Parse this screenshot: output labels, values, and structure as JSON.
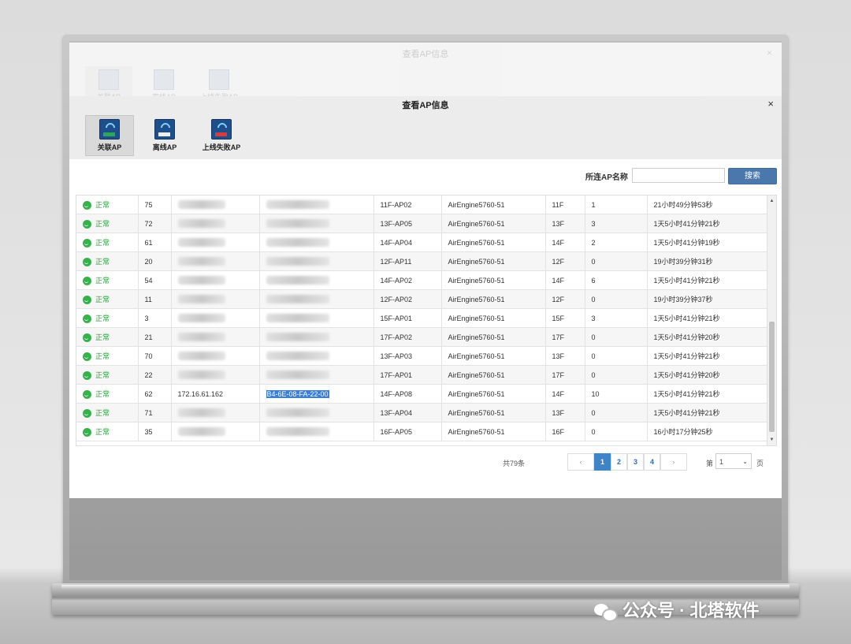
{
  "dialog": {
    "title": "查看AP信息",
    "close": "×",
    "tabs": [
      {
        "label": "关联AP",
        "icon": "associated-ap-icon",
        "active": true
      },
      {
        "label": "离线AP",
        "icon": "offline-ap-icon",
        "active": false
      },
      {
        "label": "上线失败AP",
        "icon": "online-failed-ap-icon",
        "active": false
      }
    ]
  },
  "search": {
    "label": "所连AP名称",
    "placeholder": "",
    "button": "搜索"
  },
  "rows": [
    {
      "status": "正常",
      "id": "75",
      "ip": "",
      "mac": "",
      "ap": "11F-AP02",
      "model": "AirEngine5760-51",
      "floor": "11F",
      "users": "1",
      "uptime": "21小时49分钟53秒"
    },
    {
      "status": "正常",
      "id": "72",
      "ip": "",
      "mac": "",
      "ap": "13F-AP05",
      "model": "AirEngine5760-51",
      "floor": "13F",
      "users": "3",
      "uptime": "1天5小时41分钟21秒"
    },
    {
      "status": "正常",
      "id": "61",
      "ip": "",
      "mac": "",
      "ap": "14F-AP04",
      "model": "AirEngine5760-51",
      "floor": "14F",
      "users": "2",
      "uptime": "1天5小时41分钟19秒"
    },
    {
      "status": "正常",
      "id": "20",
      "ip": "",
      "mac": "",
      "ap": "12F-AP11",
      "model": "AirEngine5760-51",
      "floor": "12F",
      "users": "0",
      "uptime": "19小时39分钟31秒"
    },
    {
      "status": "正常",
      "id": "54",
      "ip": "",
      "mac": "",
      "ap": "14F-AP02",
      "model": "AirEngine5760-51",
      "floor": "14F",
      "users": "6",
      "uptime": "1天5小时41分钟21秒"
    },
    {
      "status": "正常",
      "id": "11",
      "ip": "",
      "mac": "",
      "ap": "12F-AP02",
      "model": "AirEngine5760-51",
      "floor": "12F",
      "users": "0",
      "uptime": "19小时39分钟37秒"
    },
    {
      "status": "正常",
      "id": "3",
      "ip": "",
      "mac": "",
      "ap": "15F-AP01",
      "model": "AirEngine5760-51",
      "floor": "15F",
      "users": "3",
      "uptime": "1天5小时41分钟21秒"
    },
    {
      "status": "正常",
      "id": "21",
      "ip": "",
      "mac": "",
      "ap": "17F-AP02",
      "model": "AirEngine5760-51",
      "floor": "17F",
      "users": "0",
      "uptime": "1天5小时41分钟20秒"
    },
    {
      "status": "正常",
      "id": "70",
      "ip": "",
      "mac": "",
      "ap": "13F-AP03",
      "model": "AirEngine5760-51",
      "floor": "13F",
      "users": "0",
      "uptime": "1天5小时41分钟21秒"
    },
    {
      "status": "正常",
      "id": "22",
      "ip": "",
      "mac": "",
      "ap": "17F-AP01",
      "model": "AirEngine5760-51",
      "floor": "17F",
      "users": "0",
      "uptime": "1天5小时41分钟20秒"
    },
    {
      "status": "正常",
      "id": "62",
      "ip": "172.16.61.162",
      "mac": "B4-6E-08-FA-22-00",
      "ap": "14F-AP08",
      "model": "AirEngine5760-51",
      "floor": "14F",
      "users": "10",
      "uptime": "1天5小时41分钟21秒"
    },
    {
      "status": "正常",
      "id": "71",
      "ip": "",
      "mac": "",
      "ap": "13F-AP04",
      "model": "AirEngine5760-51",
      "floor": "13F",
      "users": "0",
      "uptime": "1天5小时41分钟21秒"
    },
    {
      "status": "正常",
      "id": "35",
      "ip": "",
      "mac": "",
      "ap": "16F-AP05",
      "model": "AirEngine5760-51",
      "floor": "16F",
      "users": "0",
      "uptime": "16小时17分钟25秒"
    }
  ],
  "pager": {
    "total": "共79条",
    "prev": "‹",
    "next": "›",
    "pages": [
      "1",
      "2",
      "3",
      "4"
    ],
    "current": "1",
    "page_prefix": "第",
    "page_select": "1",
    "page_suffix": "页"
  },
  "watermark": "公众号 · 北塔软件"
}
